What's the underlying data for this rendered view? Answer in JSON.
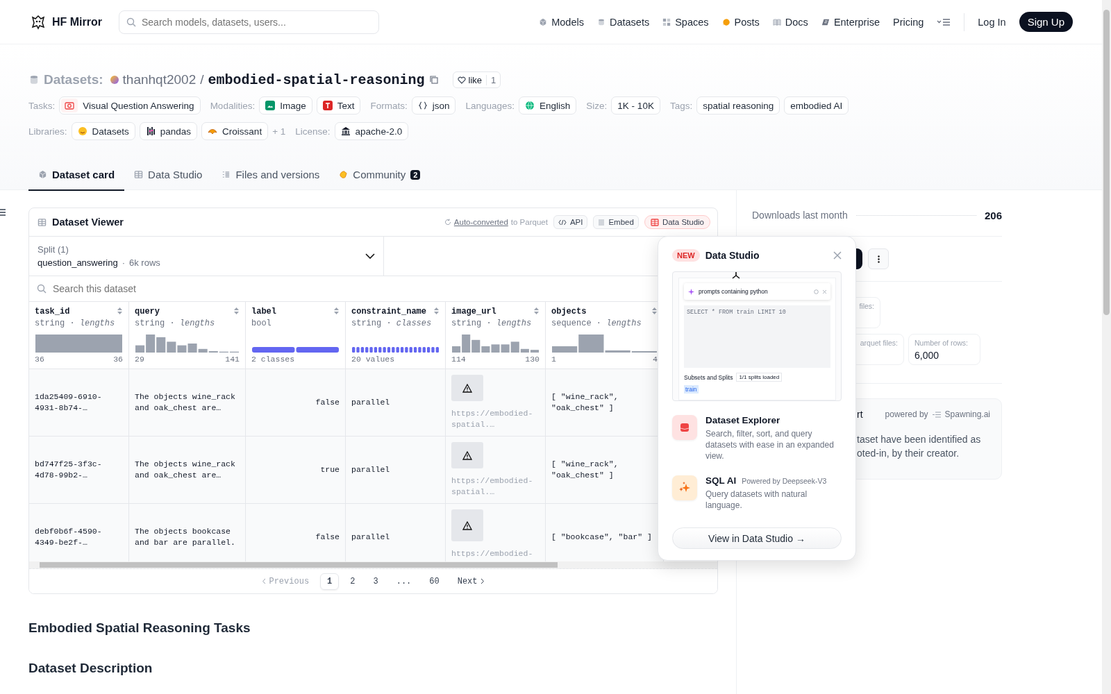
{
  "nav": {
    "brand": "HF Mirror",
    "search_placeholder": "Search models, datasets, users...",
    "links": [
      {
        "label": "Models"
      },
      {
        "label": "Datasets"
      },
      {
        "label": "Spaces"
      },
      {
        "label": "Posts"
      },
      {
        "label": "Docs"
      },
      {
        "label": "Enterprise"
      },
      {
        "label": "Pricing"
      }
    ],
    "login": "Log In",
    "signup": "Sign Up"
  },
  "repo": {
    "section": "Datasets:",
    "owner": "thanhqt2002",
    "separator": "/",
    "name": "embodied-spatial-reasoning",
    "like_label": "like",
    "like_count": "1"
  },
  "meta_rows": [
    {
      "groups": [
        {
          "label": "Tasks:",
          "tags": [
            "Visual Question Answering"
          ]
        },
        {
          "label": "Modalities:",
          "tags": [
            "Image",
            "Text"
          ]
        },
        {
          "label": "Formats:",
          "tags": [
            "json"
          ]
        },
        {
          "label": "Languages:",
          "tags": [
            "English"
          ]
        },
        {
          "label": "Size:",
          "tags": [
            "1K - 10K"
          ]
        },
        {
          "label": "Tags:",
          "tags": [
            "spatial reasoning",
            "embodied AI"
          ]
        }
      ]
    },
    {
      "groups": [
        {
          "label": "Libraries:",
          "tags": [
            "Datasets",
            "pandas",
            "Croissant"
          ],
          "more": "+ 1"
        },
        {
          "label": "License:",
          "tags": [
            "apache-2.0"
          ]
        }
      ]
    }
  ],
  "tabs": [
    {
      "label": "Dataset card",
      "selected": true
    },
    {
      "label": "Data Studio",
      "selected": false
    },
    {
      "label": "Files and versions",
      "selected": false
    },
    {
      "label": "Community",
      "badge": "2",
      "selected": false
    }
  ],
  "viewer": {
    "title": "Dataset Viewer",
    "converted_link": "Auto-converted",
    "converted_rest": "to Parquet",
    "actions": [
      {
        "label": "API",
        "kind": "code"
      },
      {
        "label": "Embed",
        "kind": "embed"
      },
      {
        "label": "Data Studio",
        "kind": "studio"
      }
    ],
    "split": {
      "label": "Split (1)",
      "name": "question_answering",
      "separator": "·",
      "rows": "6k rows"
    },
    "search_placeholder": "Search this dataset",
    "columns": [
      {
        "name": "task_id",
        "type_line": "string · *lengths*",
        "kind": "histogram",
        "min": "36",
        "max": "36"
      },
      {
        "name": "query",
        "type_line": "string · *lengths*",
        "kind": "histogram",
        "min": "29",
        "max": "141"
      },
      {
        "name": "label",
        "type_line": "bool",
        "kind": "bool",
        "summary": "2 classes"
      },
      {
        "name": "constraint_name",
        "type_line": "string · *classes*",
        "kind": "classes",
        "summary": "20 values"
      },
      {
        "name": "image_url",
        "type_line": "string · *lengths*",
        "kind": "image",
        "min": "114",
        "max": "130"
      },
      {
        "name": "objects",
        "type_line": "sequence · *lengths*",
        "kind": "histogram",
        "min": "1",
        "max": "4"
      }
    ],
    "rows": [
      [
        "1da25409-6910-4931-8b74-…",
        "The objects wine_rack and oak_chest are…",
        "false",
        "parallel",
        "https://embodied-spatial.…",
        "[ \"wine_rack\", \"oak_chest\" ]"
      ],
      [
        "bd747f25-3f3c-4d78-99b2-…",
        "The objects wine_rack and oak_chest are…",
        "true",
        "parallel",
        "https://embodied-spatial.…",
        "[ \"wine_rack\", \"oak_chest\" ]"
      ],
      [
        "debf0b6f-4590-4349-be2f-…",
        "The objects bookcase and bar are parallel.",
        "false",
        "parallel",
        "https://embodied-",
        "[ \"bookcase\", \"bar\" ]"
      ]
    ],
    "pagination": {
      "previous": "Previous",
      "pages": [
        {
          "label": "1",
          "selected": true
        },
        {
          "label": "2",
          "selected": false
        },
        {
          "label": "3",
          "selected": false
        },
        {
          "label": "...",
          "selected": false
        },
        {
          "label": "60",
          "selected": false
        }
      ],
      "next": "Next"
    }
  },
  "headings": [
    "Embodied Spatial Reasoning Tasks",
    "Dataset Description"
  ],
  "sidebar": {
    "downloads_label": "Downloads last month",
    "downloads": "206",
    "stat_cards": [
      {
        "label": "files:"
      },
      {
        "label": "arquet files:"
      },
      {
        "label": "Number of rows:",
        "value": "6,000"
      }
    ],
    "notice": {
      "title": "rt",
      "powered_by": "powered by",
      "provider": "Spawning.ai",
      "lines": [
        "taset have been identified as",
        "oted-in, by their creator."
      ]
    }
  },
  "popup": {
    "badge": "NEW",
    "title": "Data Studio",
    "preview": {
      "query": "prompts containing python",
      "sql": "SELECT * FROM train LIMIT 10",
      "subsets": "Subsets and Splits",
      "loaded": "1/1 splits loaded",
      "split": "train"
    },
    "features": [
      {
        "title": "Dataset Explorer",
        "description": "Search, filter, sort, and query datasets with ease in an expanded view."
      },
      {
        "title": "SQL AI",
        "note": "Powered by Deepseek-V3",
        "description": "Query datasets with natural language."
      }
    ],
    "button": "View in Data Studio →"
  }
}
